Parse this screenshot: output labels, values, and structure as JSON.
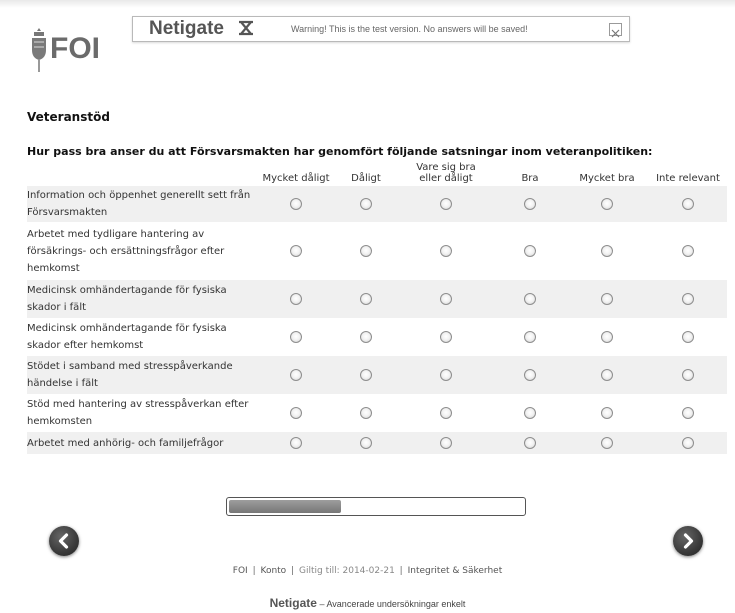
{
  "header": {
    "logo_text": "FOI",
    "brand": "Netigate",
    "warning": "Warning! This is the test version. No answers will be saved!",
    "close_icon": "close-icon"
  },
  "survey": {
    "section_title": "Veteranstöd",
    "question": "Hur pass bra anser du att Försvarsmakten har genomfört följande satsningar inom veteranpolitiken:",
    "columns": [
      "Mycket dåligt",
      "Dåligt",
      "Vare sig bra eller dåligt",
      "Bra",
      "Mycket bra",
      "Inte relevant"
    ],
    "rows": [
      "Information och öppenhet generellt sett från Försvarsmakten",
      "Arbetet med tydligare hantering av försäkrings- och ersättningsfrågor efter hemkomst",
      "Medicinsk omhändertagande för fysiska skador i fält",
      "Medicinsk omhändertagande för fysiska skador efter hemkomst",
      "Stödet i samband med stresspåverkande händelse i fält",
      "Stöd med hantering av stresspåverkan efter hemkomsten",
      "Arbetet med anhörig- och familjefrågor"
    ]
  },
  "progress": {
    "fraction": 0.38
  },
  "nav": {
    "prev_icon": "chevron-left-icon",
    "next_icon": "chevron-right-icon"
  },
  "footer": {
    "org": "FOI",
    "account": "Konto",
    "valid_until": "Giltig till: 2014-02-21",
    "privacy": "Integritet & Säkerhet",
    "powered_brand": "Netigate",
    "powered_tagline": "– Avancerade undersökningar enkelt"
  },
  "colors": {
    "row_shade": "#f0f0f0",
    "nav_button": "#3a3a3a",
    "progress_fill": "#8a8a8a"
  }
}
